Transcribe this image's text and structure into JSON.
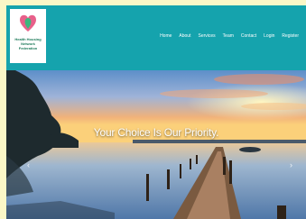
{
  "logo": {
    "text": "Health Housing Network Federation",
    "icon": "heart-leaf-icon"
  },
  "nav": {
    "items": [
      {
        "label": "Home"
      },
      {
        "label": "About"
      },
      {
        "label": "Services"
      },
      {
        "label": "Team"
      },
      {
        "label": "Contact"
      },
      {
        "label": "Login"
      },
      {
        "label": "Register"
      }
    ]
  },
  "hero": {
    "title": "Your Choice Is Our Priority.",
    "prev_icon": "chevron-left-icon",
    "next_icon": "chevron-right-icon"
  },
  "colors": {
    "header": "#15a3ad",
    "page_background": "#fbf7c7"
  }
}
